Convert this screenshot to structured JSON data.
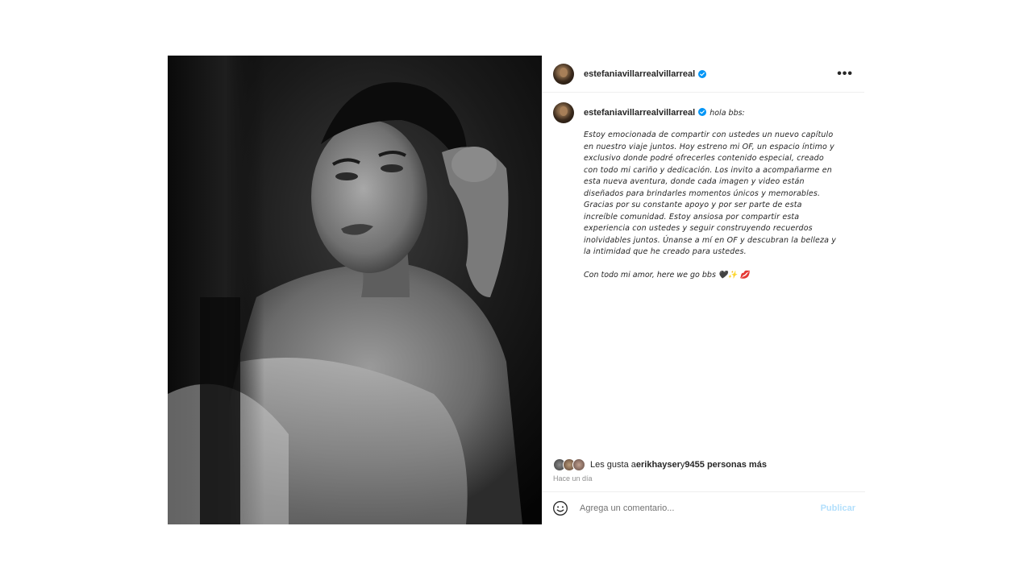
{
  "post": {
    "image_alt_description_icon": "black-and-white-portrait-photo",
    "header": {
      "username": "estefaniavillarrealvillarreal",
      "more_label": "•••"
    },
    "caption": {
      "username": "estefaniavillarrealvillarreal",
      "greeting": "hola bbs:",
      "text": "Estoy emocionada de compartir con ustedes un nuevo capítulo\nen nuestro viaje juntos. Hoy estreno mi OF, un espacio íntimo y\nexclusivo donde podré ofrecerles contenido especial, creado\ncon todo mi cariño y dedicación. Los invito a acompañarme en\nesta nueva aventura, donde cada imagen y video están\ndiseñados para brindarles momentos únicos y memorables.\nGracias por su constante apoyo y por ser parte de esta\nincreíble comunidad. Estoy ansiosa por compartir esta\nexperiencia con ustedes y seguir construyendo recuerdos\ninolvidables juntos. Únanse a mí en OF y descubran la belleza y\nla intimidad que he creado para ustedes.",
      "signoff": "Con todo mi amor, here we go bbs 🖤✨ 💋"
    },
    "likes": {
      "prefix": "Les gusta a ",
      "user": "erikhayser",
      "connector": " y ",
      "count_text": "9455 personas más"
    },
    "time": "Hace un día",
    "comment": {
      "placeholder": "Agrega un comentario...",
      "value": "",
      "publish_label": "Publicar"
    },
    "colors": {
      "verified": "#0095f6",
      "publish_disabled": "#b2dffc",
      "muted_text": "#8e8e8e"
    }
  }
}
